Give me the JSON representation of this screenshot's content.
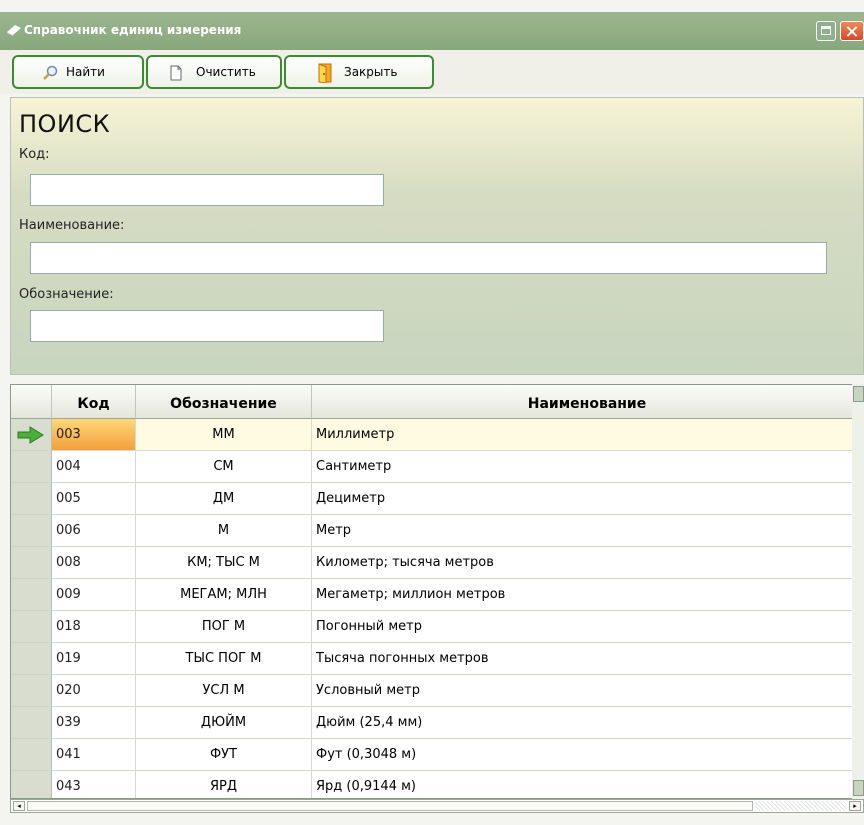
{
  "window": {
    "title": "Справочник единиц измерения"
  },
  "toolbar": {
    "find": "Найти",
    "clear": "Очистить",
    "close": "Закрыть"
  },
  "search": {
    "title": "ПОИСК",
    "code_label": "Код:",
    "name_label": "Наименование:",
    "symbol_label": "Обозначение:",
    "code_value": "",
    "name_value": "",
    "symbol_value": ""
  },
  "grid": {
    "columns": {
      "code": "Код",
      "symbol": "Обозначение",
      "name": "Наименование"
    },
    "rows": [
      {
        "code": "003",
        "symbol": "ММ",
        "name": "Миллиметр"
      },
      {
        "code": "004",
        "symbol": "СМ",
        "name": "Сантиметр"
      },
      {
        "code": "005",
        "symbol": "ДМ",
        "name": "Дециметр"
      },
      {
        "code": "006",
        "symbol": "М",
        "name": "Метр"
      },
      {
        "code": "008",
        "symbol": "КМ; ТЫС М",
        "name": "Километр; тысяча метров"
      },
      {
        "code": "009",
        "symbol": "МЕГАМ; МЛН",
        "name": "Мегаметр; миллион метров"
      },
      {
        "code": "018",
        "symbol": "ПОГ М",
        "name": "Погонный метр"
      },
      {
        "code": "019",
        "symbol": "ТЫС ПОГ М",
        "name": "Тысяча погонных метров"
      },
      {
        "code": "020",
        "symbol": "УСЛ М",
        "name": "Условный метр"
      },
      {
        "code": "039",
        "symbol": "ДЮЙМ",
        "name": "Дюйм (25,4 мм)"
      },
      {
        "code": "041",
        "symbol": "ФУТ",
        "name": "Фут (0,3048 м)"
      },
      {
        "code": "043",
        "symbol": "ЯРД",
        "name": "Ярд (0,9144 м)"
      }
    ]
  },
  "colors": {
    "titlebar": "#8fae83",
    "button_border": "#3d8a35",
    "selected_cell": "#f2a03a"
  }
}
